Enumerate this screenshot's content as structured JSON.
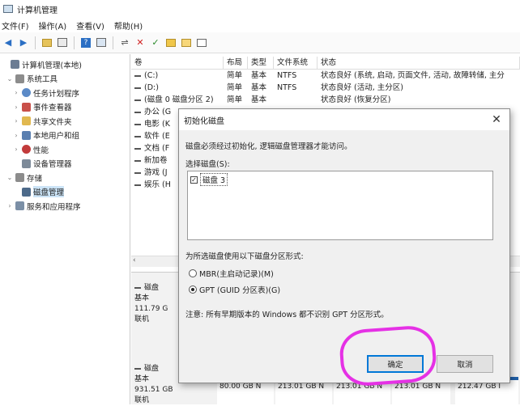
{
  "window": {
    "title": "计算机管理"
  },
  "menu": [
    "文件(F)",
    "操作(A)",
    "查看(V)",
    "帮助(H)"
  ],
  "toolbar_icons": [
    "back-arrow-icon",
    "forward-arrow-icon",
    "up-folder-icon",
    "show-tree-icon",
    "help-icon",
    "properties-icon",
    "connect-icon",
    "delete-icon",
    "check-icon",
    "folder-icon",
    "folder-open-icon",
    "list-icon"
  ],
  "tree": [
    {
      "label": "计算机管理(本地)",
      "level": 0,
      "chevron": "",
      "icon_color": "#6b7c93"
    },
    {
      "label": "系统工具",
      "level": 1,
      "chevron": "⌄",
      "icon_color": "#8c8c8c"
    },
    {
      "label": "任务计划程序",
      "level": 2,
      "chevron": "›",
      "icon_color": "#5b8ac7"
    },
    {
      "label": "事件查看器",
      "level": 2,
      "chevron": "›",
      "icon_color": "#c9504a"
    },
    {
      "label": "共享文件夹",
      "level": 2,
      "chevron": "›",
      "icon_color": "#e1b84f"
    },
    {
      "label": "本地用户和组",
      "level": 2,
      "chevron": "›",
      "icon_color": "#5a7fb0"
    },
    {
      "label": "性能",
      "level": 2,
      "chevron": "›",
      "icon_color": "#c23b3b"
    },
    {
      "label": "设备管理器",
      "level": 2,
      "chevron": "",
      "icon_color": "#7d8a99"
    },
    {
      "label": "存储",
      "level": 1,
      "chevron": "⌄",
      "icon_color": "#8c8c8c"
    },
    {
      "label": "磁盘管理",
      "level": 2,
      "chevron": "",
      "icon_color": "#4d6a8a",
      "selected": true
    },
    {
      "label": "服务和应用程序",
      "level": 1,
      "chevron": "›",
      "icon_color": "#7b8fa6"
    }
  ],
  "table": {
    "headers": [
      "卷",
      "布局",
      "类型",
      "文件系统",
      "状态"
    ],
    "rows": [
      [
        "(C:)",
        "简单",
        "基本",
        "NTFS",
        "状态良好 (系统, 启动, 页面文件, 活动, 故障转储, 主分"
      ],
      [
        "(D:)",
        "简单",
        "基本",
        "NTFS",
        "状态良好 (活动, 主分区)"
      ],
      [
        "(磁盘 0 磁盘分区 2)",
        "简单",
        "基本",
        "",
        "状态良好 (恢复分区)"
      ],
      [
        "办公 (G",
        "",
        "",
        "",
        ""
      ],
      [
        "电影 (K",
        "",
        "",
        "",
        ""
      ],
      [
        "软件 (E",
        "",
        "",
        "",
        ""
      ],
      [
        "文档 (F",
        "",
        "",
        "",
        ""
      ],
      [
        "新加卷",
        "",
        "",
        "",
        ""
      ],
      [
        "游戏 (J",
        "",
        "",
        "",
        ""
      ],
      [
        "娱乐 (H",
        "",
        "",
        "",
        ""
      ]
    ]
  },
  "scroll_arrow": "‹",
  "disks": [
    {
      "name": "磁盘",
      "type": "基本",
      "size": "111.79 G",
      "status": "联机"
    },
    {
      "name": "磁盘",
      "type": "基本",
      "size": "931.51 GB",
      "status": "联机"
    }
  ],
  "partitions": [
    "80.00 GB N",
    "213.01 GB N",
    "213.01 GB N",
    "213.01 GB N",
    "212.47 GB I"
  ],
  "dialog": {
    "title": "初始化磁盘",
    "close": "✕",
    "intro": "磁盘必须经过初始化, 逻辑磁盘管理器才能访问。",
    "select_label": "选择磁盘(S):",
    "disk_item": "磁盘 3",
    "check_mark": "✓",
    "style_label": "为所选磁盘使用以下磁盘分区形式:",
    "option_mbr": "MBR(主启动记录)(M)",
    "option_gpt": "GPT (GUID 分区表)(G)",
    "note": "注意: 所有早期版本的 Windows 都不识别 GPT 分区形式。",
    "ok": "确定",
    "cancel": "取消"
  },
  "colors": {
    "highlight": "#e531e5",
    "selected": "#cce4f7",
    "partition_blue": "#1f5fa8"
  }
}
